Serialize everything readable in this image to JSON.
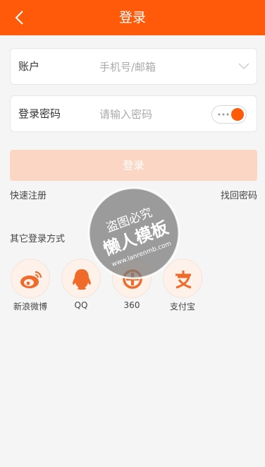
{
  "header": {
    "title": "登录",
    "back_icon": "back-arrow-icon"
  },
  "account": {
    "label": "账户",
    "placeholder": "手机号/邮箱",
    "dropdown_icon": "chevron-down-icon"
  },
  "password": {
    "label": "登录密码",
    "placeholder": "请输入密码",
    "toggle_on": true
  },
  "login_button": {
    "label": "登录"
  },
  "links": {
    "register": "快速注册",
    "forgot": "找回密码"
  },
  "other": {
    "title": "其它登录方式",
    "items": [
      {
        "label": "新浪微博",
        "icon": "weibo-icon"
      },
      {
        "label": "QQ",
        "icon": "qq-icon"
      },
      {
        "label": "360",
        "icon": "360-icon"
      },
      {
        "label": "支付宝",
        "icon": "alipay-icon"
      }
    ]
  },
  "watermark": {
    "line1": "盗图必究",
    "line2": "懒人模板",
    "url": "www.lanrenmb.com"
  },
  "colors": {
    "accent": "#ff5a0a",
    "button_disabled": "#fcd6c4",
    "background": "#f5f5f5"
  }
}
